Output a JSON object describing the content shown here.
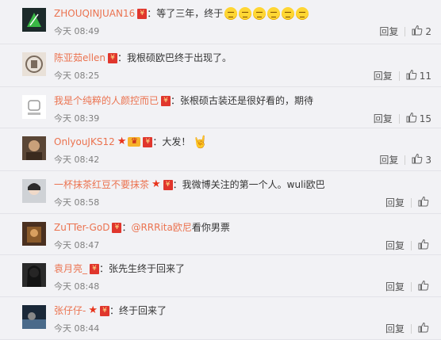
{
  "comments": [
    {
      "name": "ZHOUQINJUAN16",
      "star": false,
      "vip": false,
      "text": "：等了三年，终于",
      "mention": "",
      "tail": "",
      "emoji_count": 6,
      "hand": false,
      "time": "今天 08:49",
      "reply": "回复",
      "likes": "2",
      "avatar_color": "#1c2a2a"
    },
    {
      "name": "陈亚茹ellen",
      "star": false,
      "vip": false,
      "text": "：我根硕欧巴终于出现了。",
      "mention": "",
      "tail": "",
      "emoji_count": 0,
      "hand": false,
      "time": "今天 08:25",
      "reply": "回复",
      "likes": "11",
      "avatar_color": "#e9e1d8"
    },
    {
      "name": "我是个纯粹的人颜控而已",
      "star": false,
      "vip": false,
      "text": "：张根硕古装还是很好看的，期待",
      "mention": "",
      "tail": "",
      "emoji_count": 0,
      "hand": false,
      "time": "今天 08:39",
      "reply": "回复",
      "likes": "15",
      "avatar_color": "#ffffff"
    },
    {
      "name": "OnlyouJKS12",
      "star": true,
      "vip": true,
      "text": "：大发！",
      "mention": "",
      "tail": "",
      "emoji_count": 0,
      "hand": true,
      "time": "今天 08:42",
      "reply": "回复",
      "likes": "3",
      "avatar_color": "#5a4636"
    },
    {
      "name": "一杯抹茶红豆不要抹茶",
      "star": true,
      "vip": false,
      "text": "：我微博关注的第一个人。wuli欧巴",
      "mention": "",
      "tail": "",
      "emoji_count": 0,
      "hand": false,
      "time": "今天 08:58",
      "reply": "回复",
      "likes": "",
      "avatar_color": "#cfd2d6"
    },
    {
      "name": "ZuTTer-GoD",
      "star": false,
      "vip": false,
      "text": "：",
      "mention": "@RRRita欧尼",
      "tail": " 看你男票",
      "emoji_count": 0,
      "hand": false,
      "time": "今天 08:47",
      "reply": "回复",
      "likes": "",
      "avatar_color": "#4a3020"
    },
    {
      "name": "袁月亮_",
      "star": false,
      "vip": false,
      "text": "：张先生终于回来了",
      "mention": "",
      "tail": "",
      "emoji_count": 0,
      "hand": false,
      "time": "今天 08:48",
      "reply": "回复",
      "likes": "",
      "avatar_color": "#2a2a2a"
    },
    {
      "name": "张仔仔-",
      "star": true,
      "vip": false,
      "text": "：终于回来了",
      "mention": "",
      "tail": "",
      "emoji_count": 0,
      "hand": false,
      "time": "今天 08:44",
      "reply": "回复",
      "likes": "",
      "avatar_color": "#1a2838"
    }
  ],
  "icons": {
    "like": "thumbs-up-icon",
    "redpacket": "red-packet-icon",
    "star": "star-icon",
    "vip": "vip-crown-icon",
    "emoji": "sleepy-face-emoji",
    "hand": "rock-hand-emoji"
  }
}
